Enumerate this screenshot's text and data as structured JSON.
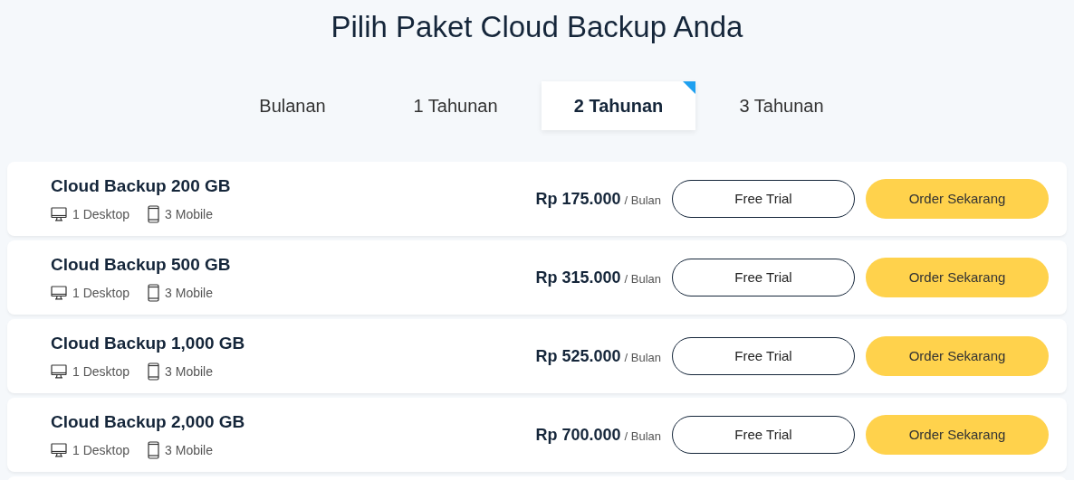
{
  "title": "Pilih Paket Cloud Backup Anda",
  "tabs": [
    {
      "label": "Bulanan",
      "selected": false
    },
    {
      "label": "1 Tahunan",
      "selected": false
    },
    {
      "label": "2 Tahunan",
      "selected": true
    },
    {
      "label": "3 Tahunan",
      "selected": false
    }
  ],
  "plans": [
    {
      "name": "Cloud Backup 200 GB",
      "desktop": "1 Desktop",
      "mobile": "3 Mobile",
      "price": "Rp 175.000",
      "period": "/ Bulan",
      "trial": "Free Trial",
      "order": "Order Sekarang"
    },
    {
      "name": "Cloud Backup 500 GB",
      "desktop": "1 Desktop",
      "mobile": "3 Mobile",
      "price": "Rp 315.000",
      "period": "/ Bulan",
      "trial": "Free Trial",
      "order": "Order Sekarang"
    },
    {
      "name": "Cloud Backup 1,000 GB",
      "desktop": "1 Desktop",
      "mobile": "3 Mobile",
      "price": "Rp 525.000",
      "period": "/ Bulan",
      "trial": "Free Trial",
      "order": "Order Sekarang"
    },
    {
      "name": "Cloud Backup 2,000 GB",
      "desktop": "1 Desktop",
      "mobile": "3 Mobile",
      "price": "Rp 700.000",
      "period": "/ Bulan",
      "trial": "Free Trial",
      "order": "Order Sekarang"
    }
  ]
}
